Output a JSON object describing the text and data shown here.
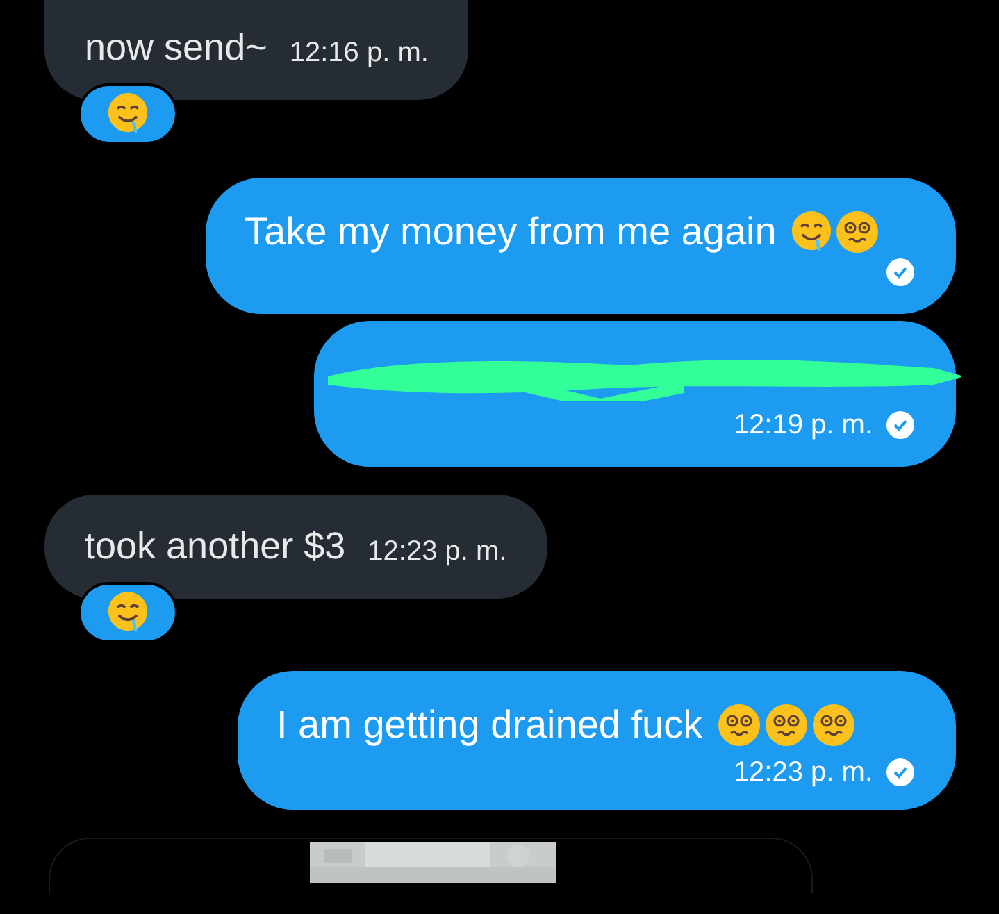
{
  "messages": [
    {
      "outgoing": false,
      "text": "now send~",
      "time": "12:16 p. m.",
      "reaction": {
        "kind": "drooling"
      }
    },
    {
      "outgoing": true,
      "text": "Take my money from me again",
      "emojis": [
        {
          "kind": "drooling"
        },
        {
          "kind": "dizzy"
        }
      ],
      "read": true
    },
    {
      "outgoing": true,
      "kind": "redacted",
      "time": "12:19 p. m.",
      "read": true
    },
    {
      "outgoing": false,
      "text": "took another $3",
      "time": "12:23 p. m.",
      "reaction": {
        "kind": "drooling"
      }
    },
    {
      "outgoing": true,
      "text": "I am getting drained fuck",
      "emojis": [
        {
          "kind": "dizzy"
        },
        {
          "kind": "dizzy"
        },
        {
          "kind": "dizzy"
        }
      ],
      "time": "12:23 p. m.",
      "read": true
    },
    {
      "outgoing": false,
      "kind": "picture"
    }
  ]
}
